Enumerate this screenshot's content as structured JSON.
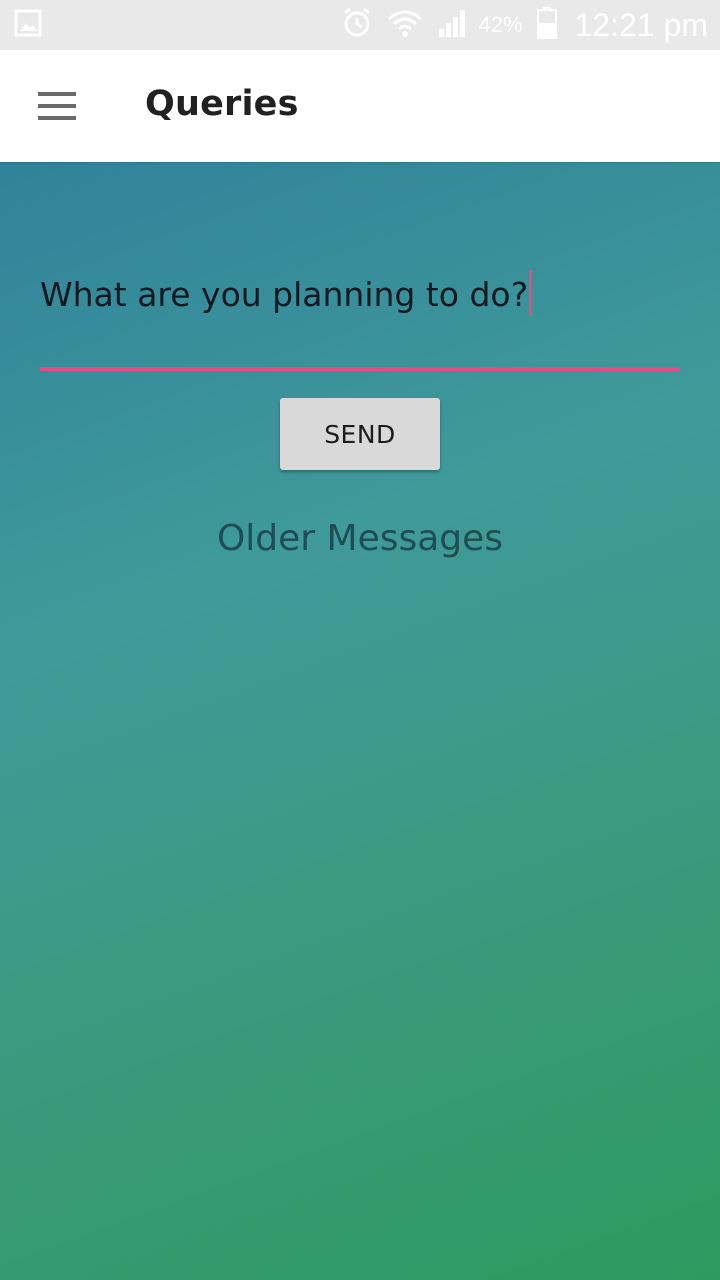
{
  "status_bar": {
    "icons": [
      "gallery-icon",
      "alarm-icon",
      "wifi-icon",
      "signal-icon",
      "battery-icon"
    ],
    "battery_percent": "42%",
    "time": "12:21 pm"
  },
  "app_bar": {
    "menu_icon": "hamburger-menu-icon",
    "title": "Queries"
  },
  "query": {
    "value": "What are you planning to do?",
    "accent_color": "#e84a83"
  },
  "send_button": {
    "label": "SEND"
  },
  "older_messages": {
    "label": "Older Messages"
  },
  "colors": {
    "gradient_top": "#2c7a9a",
    "gradient_bottom": "#2f9a5f",
    "accent": "#e84a83"
  }
}
